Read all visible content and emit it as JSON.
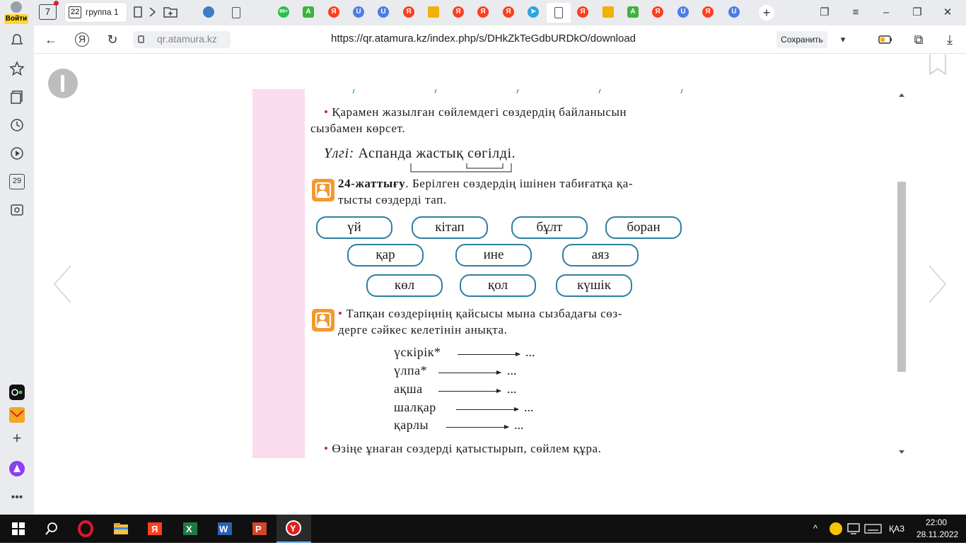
{
  "browser": {
    "account_label": "Войти",
    "tab_group_count": "7",
    "tab_group": {
      "count": "22",
      "label": "группа 1"
    },
    "tab_favicons": [
      "earth",
      "doc",
      "wa",
      "green",
      "ya",
      "u",
      "u",
      "ya",
      "pic",
      "ya",
      "ya",
      "ya",
      "tg",
      "doc",
      "ya",
      "pic",
      "green",
      "ya",
      "u",
      "ya",
      "u"
    ],
    "whatsapp_badge": "99+",
    "domain": "qr.atamura.kz",
    "url": "https://qr.atamura.kz/index.php/s/DHkZkTeGdbURDkO/download",
    "save_label": "Сохранить",
    "sidebar_badge": "29"
  },
  "page": {
    "instruction_1": "Қарамен жазылған сөйлемдегі сөздердің байланысын",
    "instruction_1b": "сызбамен көрсет.",
    "example_label": "Үлгі:",
    "example_sentence": "Аспанда жастық сөгілді.",
    "task_number": "24-жаттығу",
    "task_text": ". Берілген сөздердің ішінен табиғатқа қа-",
    "task_text_b": "тысты сөздерді тап.",
    "words_row1": [
      "үй",
      "кітап",
      "бұлт",
      "боран"
    ],
    "words_row2": [
      "қар",
      "ине",
      "аяз"
    ],
    "words_row3": [
      "көл",
      "қол",
      "күшік"
    ],
    "instruction_2": "Тапқан сөздеріңнің қайсысы мына сызбадағы сөз-",
    "instruction_2b": "дерге сәйкес келетінін анықта.",
    "chain_words": [
      "үскірік*",
      "үлпа*",
      "ақша",
      "шалқар",
      "қарлы"
    ],
    "chain_dots": "...",
    "instruction_3": "Өзіңе ұнаған сөздерді қатыстырып, сөйлем құра."
  },
  "taskbar": {
    "language": "ҚАЗ",
    "time": "22:00",
    "date": "28.11.2022"
  }
}
